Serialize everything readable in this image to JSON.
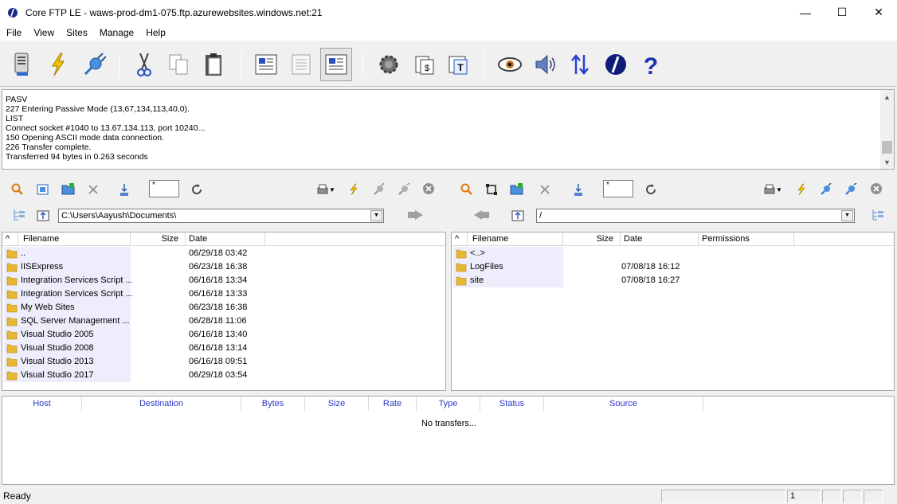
{
  "window": {
    "title": "Core FTP LE - waws-prod-dm1-075.ftp.azurewebsites.windows.net:21",
    "minimize": "—",
    "maximize": "☐",
    "close": "✕"
  },
  "menu": [
    "File",
    "View",
    "Sites",
    "Manage",
    "Help"
  ],
  "log": {
    "lines": [
      "PASV",
      "227 Entering Passive Mode (13,67,134,113,40,0).",
      "LIST",
      "Connect socket #1040 to 13.67.134.113, port 10240...",
      "150 Opening ASCII mode data connection.",
      "226 Transfer complete.",
      "Transferred 94 bytes in 0.263 seconds"
    ]
  },
  "local": {
    "filter": "*",
    "path": "C:\\Users\\Aayush\\Documents\\",
    "columns": {
      "sort": "^",
      "name": "Filename",
      "size": "Size",
      "date": "Date"
    },
    "files": [
      {
        "name": "..",
        "date": "06/29/18  03:42"
      },
      {
        "name": "IISExpress",
        "date": "06/23/18  16:38"
      },
      {
        "name": "Integration Services Script ...",
        "date": "06/16/18  13:34"
      },
      {
        "name": "Integration Services Script ...",
        "date": "06/16/18  13:33"
      },
      {
        "name": "My Web Sites",
        "date": "06/23/18  16:38"
      },
      {
        "name": "SQL Server Management ...",
        "date": "06/28/18  11:06"
      },
      {
        "name": "Visual Studio 2005",
        "date": "06/16/18  13:40"
      },
      {
        "name": "Visual Studio 2008",
        "date": "06/16/18  13:14"
      },
      {
        "name": "Visual Studio 2013",
        "date": "06/16/18  09:51"
      },
      {
        "name": "Visual Studio 2017",
        "date": "06/29/18  03:54"
      }
    ]
  },
  "remote": {
    "filter": "*",
    "path": "/",
    "columns": {
      "sort": "^",
      "name": "Filename",
      "size": "Size",
      "date": "Date",
      "permissions": "Permissions"
    },
    "files": [
      {
        "name": "<..>",
        "date": ""
      },
      {
        "name": "LogFiles",
        "date": "07/08/18  16:12"
      },
      {
        "name": "site",
        "date": "07/08/18  16:27"
      }
    ]
  },
  "transfers": {
    "columns": [
      "Host",
      "Destination",
      "Bytes",
      "Size",
      "Rate",
      "Type",
      "Status",
      "Source"
    ],
    "empty": "No transfers..."
  },
  "status": {
    "text": "Ready",
    "counter": "1"
  },
  "colors": {
    "accent_header": "#2a38c8",
    "folder": "#e8b830",
    "name_highlight": "#ededfb"
  }
}
